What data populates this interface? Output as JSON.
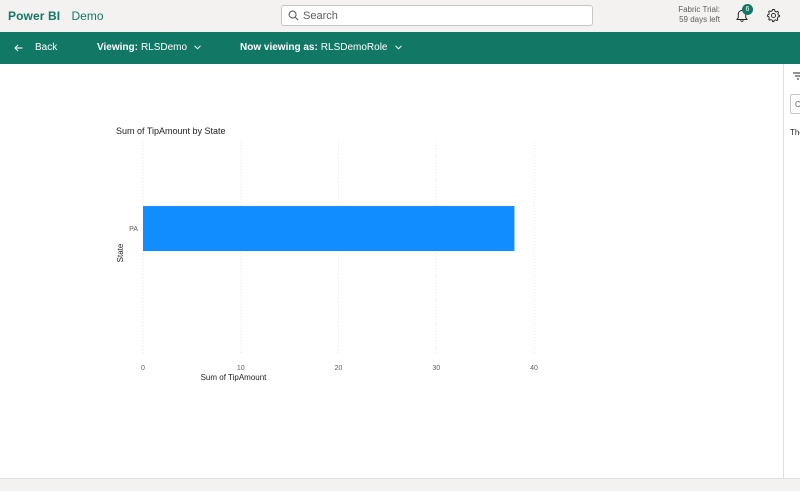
{
  "header": {
    "app_name": "Power BI",
    "workspace": "Demo",
    "search_placeholder": "Search",
    "trial_line1": "Fabric Trial:",
    "trial_line2": "59 days left",
    "notification_count": "6"
  },
  "viewbar": {
    "back_label": "Back",
    "viewing_label": "Viewing:",
    "viewing_value": "RLSDemo",
    "viewing_as_label": "Now viewing as:",
    "viewing_as_value": "RLSDemoRole"
  },
  "right_pane": {
    "box_text": "C",
    "partial_text": "The"
  },
  "colors": {
    "brand_green": "#117865",
    "bar_blue": "#118DFF"
  },
  "chart_data": {
    "type": "bar",
    "orientation": "horizontal",
    "title": "Sum of TipAmount by State",
    "xlabel": "Sum of TipAmount",
    "ylabel": "State",
    "categories": [
      "PA"
    ],
    "values": [
      38
    ],
    "xlim": [
      0,
      40
    ],
    "x_ticks": [
      0,
      10,
      20,
      30,
      40
    ],
    "grid": true,
    "legend": "none"
  }
}
